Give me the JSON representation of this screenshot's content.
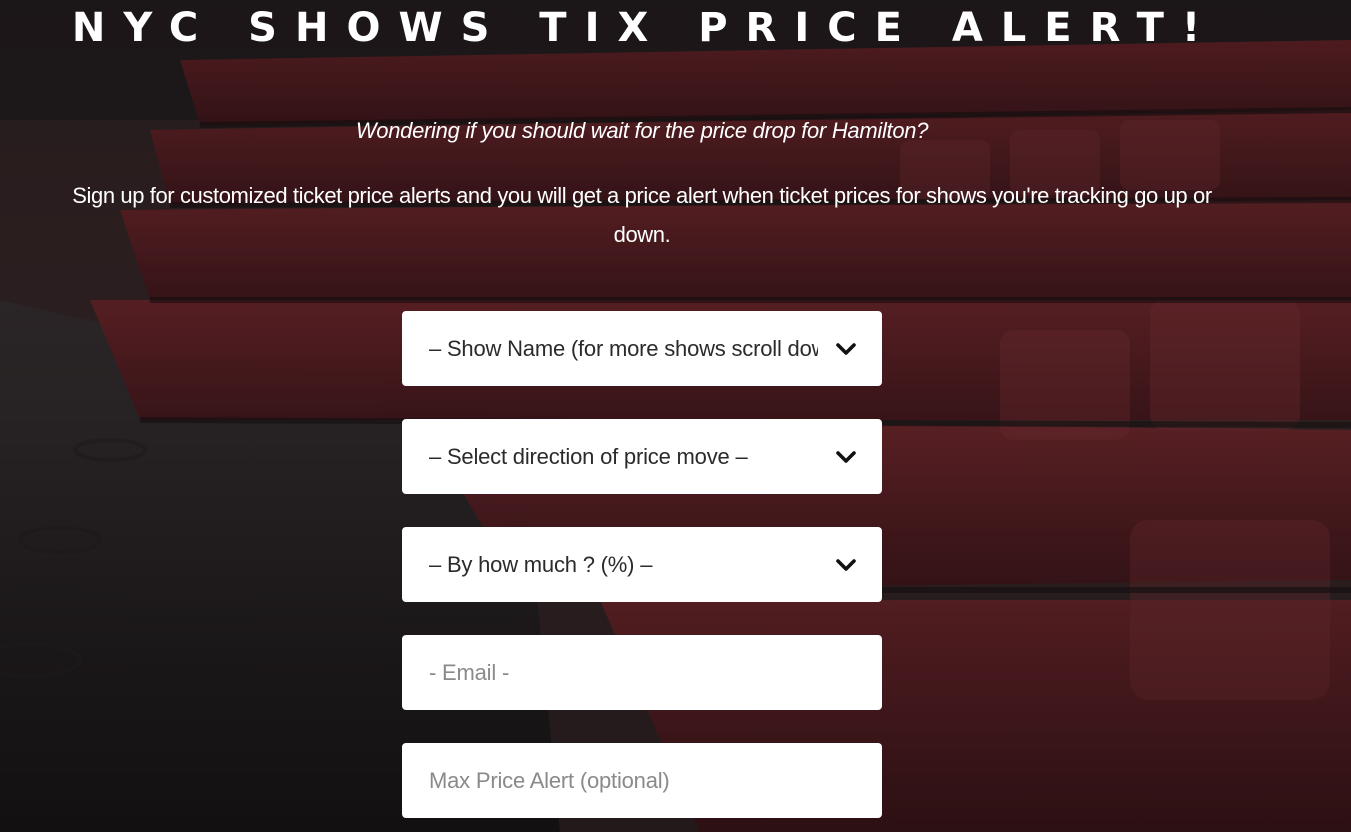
{
  "header": {
    "title": "NYC SHOWS TIX PRICE ALERT!"
  },
  "intro": {
    "subtitle": "Wondering if you should wait for the price drop for Hamilton?",
    "description": "Sign up for customized ticket price alerts and you will get a price alert when ticket prices for shows you're tracking go up or down."
  },
  "form": {
    "show_select": {
      "value": "– Show Name (for more shows scroll down) –",
      "icon": "chevron-down-icon"
    },
    "direction_select": {
      "value": "– Select direction of price move –",
      "icon": "chevron-down-icon"
    },
    "amount_select": {
      "value": "– By how much ? (%) –",
      "icon": "chevron-down-icon"
    },
    "email": {
      "placeholder": "- Email -"
    },
    "max_price": {
      "placeholder": "Max Price Alert (optional)"
    }
  },
  "colors": {
    "text": "#ffffff",
    "field_background": "#ffffff",
    "seat_red": "#6e1f26",
    "overlay": "#1c1416"
  }
}
